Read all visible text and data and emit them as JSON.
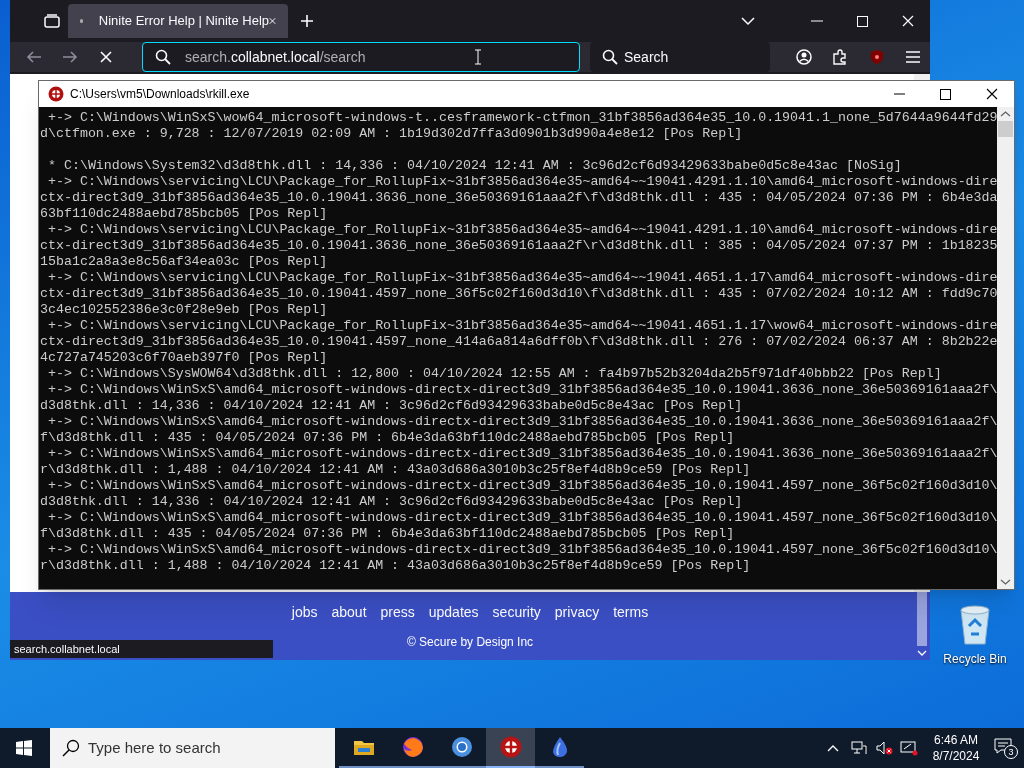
{
  "browser": {
    "tabs": [
      {
        "title": "Ninite Error Help | Ninite Help",
        "selected": true
      }
    ],
    "address": {
      "prefix": "search.",
      "domain": "collabnet.local",
      "path": "/search"
    },
    "search_placeholder": "Search",
    "footer_links": [
      "jobs",
      "about",
      "press",
      "updates",
      "security",
      "privacy",
      "terms"
    ],
    "copyright": "© Secure by Design Inc",
    "status_url": "search.collabnet.local"
  },
  "console": {
    "title": "C:\\Users\\vm5\\Downloads\\rkill.exe",
    "lines": [
      {
        "kind": "text",
        "text": " +-> C:\\Windows\\WinSxS\\wow64_microsoft-windows-t..cesframework-ctfmon_31bf3856ad364e35_10.0.19041.1_none_5d7644a9644fd29"
      },
      {
        "kind": "text",
        "text": "d\\ctfmon.exe : 9,728 : 12/07/2019 02:09 AM : 1b19d302d7ffa3d0901b3d990a4e8e12 [Pos Repl]"
      },
      {
        "kind": "blank"
      },
      {
        "kind": "text",
        "text": " * C:\\Windows\\System32\\d3d8thk.dll : 14,336 : 04/10/2024 12:41 AM : 3c96d2cf6d93429633babe0d5c8e43ac [NoSig]"
      },
      {
        "kind": "text",
        "text": " +-> C:\\Windows\\servicing\\LCU\\Package_for_RollupFix~31bf3856ad364e35~amd64~~19041.4291.1.10\\amd64_microsoft-windows-dire"
      },
      {
        "kind": "text",
        "text": "ctx-direct3d9_31bf3856ad364e35_10.0.19041.3636_none_36e50369161aaa2f\\f\\d3d8thk.dll : 435 : 04/05/2024 07:36 PM : 6b4e3da"
      },
      {
        "kind": "text",
        "text": "63bf110dc2488aebd785bcb05 [Pos Repl]"
      },
      {
        "kind": "text",
        "text": " +-> C:\\Windows\\servicing\\LCU\\Package_for_RollupFix~31bf3856ad364e35~amd64~~19041.4291.1.10\\amd64_microsoft-windows-dire"
      },
      {
        "kind": "text",
        "text": "ctx-direct3d9_31bf3856ad364e35_10.0.19041.3636_none_36e50369161aaa2f\\r\\d3d8thk.dll : 385 : 04/05/2024 07:37 PM : 1b18235"
      },
      {
        "kind": "text",
        "text": "15ba1c2a8a3e8c56af34ea03c [Pos Repl]"
      },
      {
        "kind": "text",
        "text": " +-> C:\\Windows\\servicing\\LCU\\Package_for_RollupFix~31bf3856ad364e35~amd64~~19041.4651.1.17\\amd64_microsoft-windows-dire"
      },
      {
        "kind": "text",
        "text": "ctx-direct3d9_31bf3856ad364e35_10.0.19041.4597_none_36f5c02f160d3d10\\f\\d3d8thk.dll : 435 : 07/02/2024 10:12 AM : fdd9c70"
      },
      {
        "kind": "text",
        "text": "3c4ec102552386e3c0f28e9eb [Pos Repl]"
      },
      {
        "kind": "text",
        "text": " +-> C:\\Windows\\servicing\\LCU\\Package_for_RollupFix~31bf3856ad364e35~amd64~~19041.4651.1.17\\wow64_microsoft-windows-dire"
      },
      {
        "kind": "text",
        "text": "ctx-direct3d9_31bf3856ad364e35_10.0.19041.4597_none_414a6a814a6dff0b\\f\\d3d8thk.dll : 276 : 07/02/2024 06:37 AM : 8b2b22e"
      },
      {
        "kind": "text",
        "text": "4c727a745203c6f70aeb397f0 [Pos Repl]"
      },
      {
        "kind": "text",
        "text": " +-> C:\\Windows\\SysWOW64\\d3d8thk.dll : 12,800 : 04/10/2024 12:55 AM : fa4b97b52b3204da2b5f971df40bbb22 [Pos Repl]"
      },
      {
        "kind": "text",
        "text": " +-> C:\\Windows\\WinSxS\\amd64_microsoft-windows-directx-direct3d9_31bf3856ad364e35_10.0.19041.3636_none_36e50369161aaa2f\\"
      },
      {
        "kind": "text",
        "text": "d3d8thk.dll : 14,336 : 04/10/2024 12:41 AM : 3c96d2cf6d93429633babe0d5c8e43ac [Pos Repl]"
      },
      {
        "kind": "text",
        "text": " +-> C:\\Windows\\WinSxS\\amd64_microsoft-windows-directx-direct3d9_31bf3856ad364e35_10.0.19041.3636_none_36e50369161aaa2f\\"
      },
      {
        "kind": "text",
        "text": "f\\d3d8thk.dll : 435 : 04/05/2024 07:36 PM : 6b4e3da63bf110dc2488aebd785bcb05 [Pos Repl]"
      },
      {
        "kind": "text",
        "text": " +-> C:\\Windows\\WinSxS\\amd64_microsoft-windows-directx-direct3d9_31bf3856ad364e35_10.0.19041.3636_none_36e50369161aaa2f\\"
      },
      {
        "kind": "text",
        "text": "r\\d3d8thk.dll : 1,488 : 04/10/2024 12:41 AM : 43a03d686a3010b3c25f8ef4d8b9ce59 [Pos Repl]"
      },
      {
        "kind": "text",
        "text": " +-> C:\\Windows\\WinSxS\\amd64_microsoft-windows-directx-direct3d9_31bf3856ad364e35_10.0.19041.4597_none_36f5c02f160d3d10\\"
      },
      {
        "kind": "text",
        "text": "d3d8thk.dll : 14,336 : 04/10/2024 12:41 AM : 3c96d2cf6d93429633babe0d5c8e43ac [Pos Repl]"
      },
      {
        "kind": "text",
        "text": " +-> C:\\Windows\\WinSxS\\amd64_microsoft-windows-directx-direct3d9_31bf3856ad364e35_10.0.19041.4597_none_36f5c02f160d3d10\\"
      },
      {
        "kind": "text",
        "text": "f\\d3d8thk.dll : 435 : 04/05/2024 07:36 PM : 6b4e3da63bf110dc2488aebd785bcb05 [Pos Repl]"
      },
      {
        "kind": "text",
        "text": " +-> C:\\Windows\\WinSxS\\amd64_microsoft-windows-directx-direct3d9_31bf3856ad364e35_10.0.19041.4597_none_36f5c02f160d3d10\\"
      },
      {
        "kind": "text",
        "text": "r\\d3d8thk.dll : 1,488 : 04/10/2024 12:41 AM : 43a03d686a3010b3c25f8ef4d8b9ce59 [Pos Repl]"
      }
    ]
  },
  "desktop": {
    "icons": [
      {
        "kind": "bin",
        "label": "Recycle Bin"
      }
    ]
  },
  "taskbar": {
    "search_placeholder": "Type here to search",
    "apps": [
      {
        "kind": "folder",
        "selected": false
      },
      {
        "kind": "fox",
        "selected": false
      },
      {
        "kind": "ring",
        "selected": false
      },
      {
        "kind": "shield",
        "selected": true
      },
      {
        "kind": "drop",
        "selected": false
      }
    ],
    "time": "6:46 AM",
    "date": "8/7/2024",
    "notification_count": "3"
  }
}
